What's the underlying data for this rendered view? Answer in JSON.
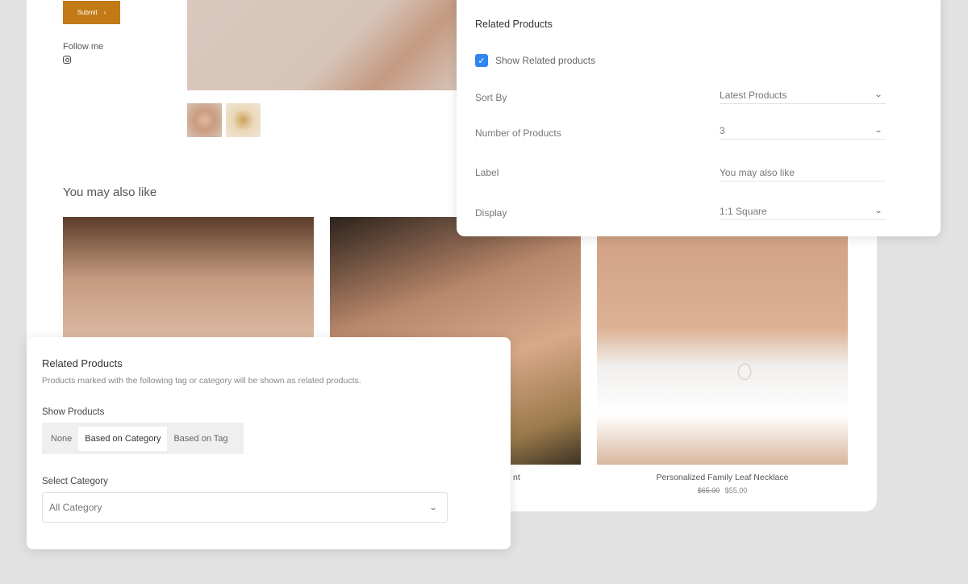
{
  "storefront": {
    "submit_label": "Submit",
    "submit_icon": "chevron-right-icon",
    "follow_label": "Follow me",
    "social_icon": "instagram-icon",
    "section_title": "You may also like",
    "products": [
      {
        "name": ""
      },
      {
        "name": "nt"
      },
      {
        "name": "Personalized Family Leaf Necklace",
        "old_price": "$65.00",
        "price": "$55.00"
      }
    ],
    "brand_color": "#c27a17"
  },
  "related_settings": {
    "title": "Related Products",
    "show_checkbox": {
      "label": "Show Related products",
      "checked": true,
      "color": "#2e86f2"
    },
    "fields": [
      {
        "label": "Sort By",
        "value": "Latest Products",
        "type": "select"
      },
      {
        "label": "Number of Products",
        "value": "3",
        "type": "select"
      },
      {
        "label": "Label",
        "value": "You may also like",
        "type": "text"
      },
      {
        "label": "Display",
        "value": "1:1 Square",
        "type": "select"
      }
    ]
  },
  "category_settings": {
    "title": "Related Products",
    "description": "Products marked with the following tag or category will be shown as related products.",
    "show_products_label": "Show Products",
    "options": [
      "None",
      "Based on Category",
      "Based on Tag"
    ],
    "selected_option": "Based on Category",
    "select_category_label": "Select Category",
    "select_category_value": "All Category"
  }
}
